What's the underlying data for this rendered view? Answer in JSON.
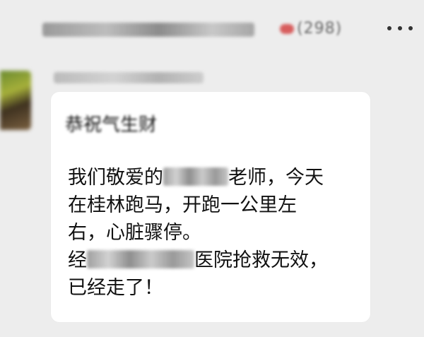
{
  "header": {
    "member_count": "(298)"
  },
  "message": {
    "quote_title": "恭祝气生财",
    "line1_before": "我们敬爱的",
    "line1_after": "老师，今天",
    "line2": "在桂林跑马，开跑一公里左",
    "line3": "右，心脏骤停。",
    "line4_before": "经",
    "line4_after": "医院抢救无效，",
    "line5": "已经走了！"
  }
}
